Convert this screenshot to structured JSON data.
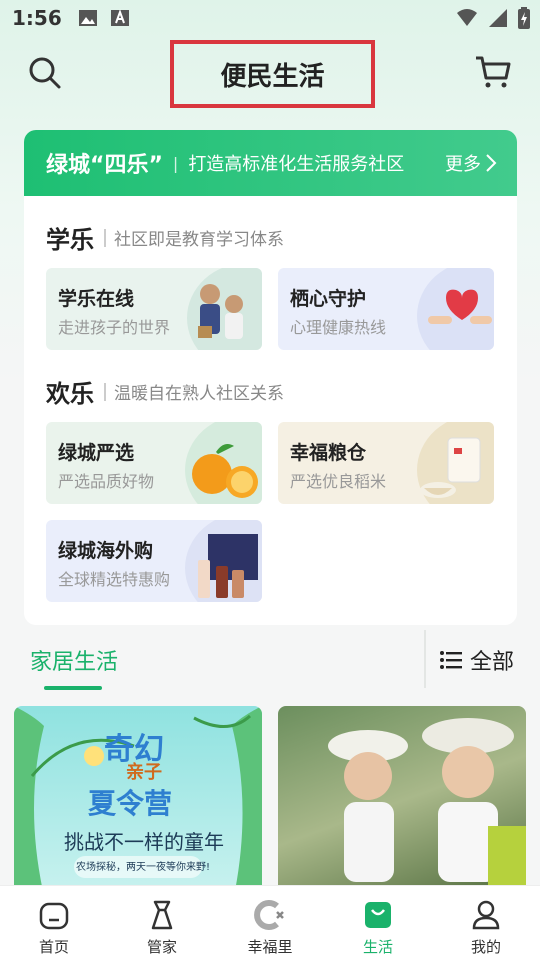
{
  "status": {
    "time": "1:56"
  },
  "header": {
    "title": "便民生活"
  },
  "banner": {
    "title": "绿城“四乐”",
    "separator": "|",
    "subtitle": "打造高标准化生活服务社区",
    "more": "更多"
  },
  "sections": [
    {
      "heading": "学乐",
      "desc": "社区即是教育学习体系",
      "tiles": [
        {
          "title": "学乐在线",
          "subtitle": "走进孩子的世界"
        },
        {
          "title": "栖心守护",
          "subtitle": "心理健康热线"
        }
      ]
    },
    {
      "heading": "欢乐",
      "desc": "温暖自在熟人社区关系",
      "tiles": [
        {
          "title": "绿城严选",
          "subtitle": "严选品质好物"
        },
        {
          "title": "幸福粮仓",
          "subtitle": "严选优良稻米"
        },
        {
          "title": "绿城海外购",
          "subtitle": "全球精选特惠购"
        }
      ]
    }
  ],
  "tabs": {
    "active": "家居生活",
    "all": "全部"
  },
  "feed": {
    "poster_title_1": "奇幻",
    "poster_title_2": "亲子",
    "poster_title_3": "夏令营",
    "poster_tagline": "挑战不一样的童年",
    "poster_sub": "农场探秘，两天一夜等你来野!"
  },
  "nav": [
    {
      "label": "首页",
      "icon": "home-icon"
    },
    {
      "label": "管家",
      "icon": "butler-icon"
    },
    {
      "label": "幸福里",
      "icon": "happiness-icon"
    },
    {
      "label": "生活",
      "icon": "shopping-bag-icon"
    },
    {
      "label": "我的",
      "icon": "profile-icon"
    }
  ],
  "colors": {
    "accent": "#1ab26b",
    "highlight_border": "#d9363e"
  }
}
